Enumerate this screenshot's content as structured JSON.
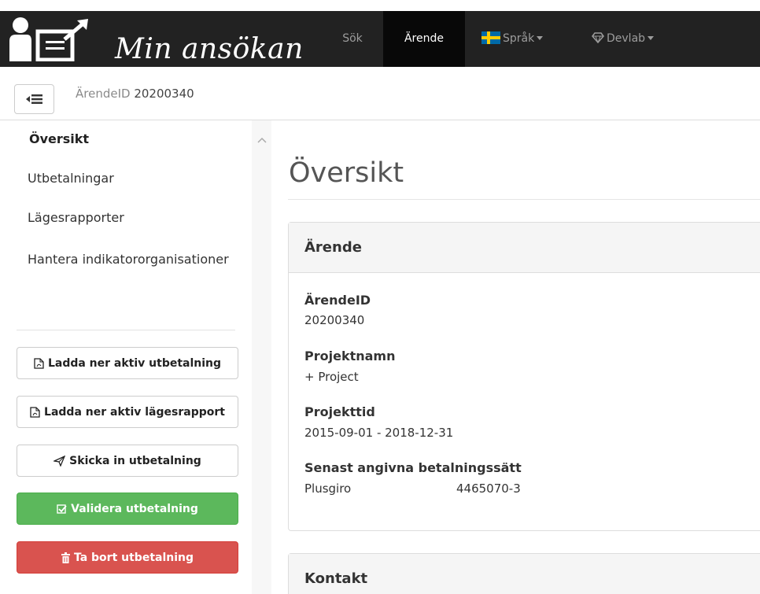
{
  "app": {
    "title": "Min ansökan"
  },
  "nav": {
    "items": [
      {
        "label": "Sök",
        "active": false
      },
      {
        "label": "Ärende",
        "active": true
      },
      {
        "label": "Språk",
        "icon": "swedish-flag-icon",
        "dropdown": true
      },
      {
        "label": "Devlab",
        "icon": "diamond-icon",
        "dropdown": true
      }
    ]
  },
  "breadcrumb": {
    "label": "ÄrendeID",
    "value": "20200340"
  },
  "sidebar": {
    "items": [
      {
        "label": "Översikt",
        "active": true
      },
      {
        "label": "Utbetalningar"
      },
      {
        "label": "Lägesrapporter"
      },
      {
        "label": "Hantera indikatororganisationer"
      }
    ],
    "buttons": [
      {
        "label": "Ladda ner aktiv utbetalning",
        "icon": "pdf-file-icon"
      },
      {
        "label": "Ladda ner aktiv lägesrapport",
        "icon": "pdf-file-icon"
      },
      {
        "label": "Skicka in utbetalning",
        "icon": "paper-plane-icon"
      },
      {
        "label": "Validera utbetalning",
        "icon": "check-square-icon",
        "color": "#5cb85c"
      },
      {
        "label": "Ta bort utbetalning",
        "icon": "trash-icon",
        "color": "#d9534f"
      }
    ]
  },
  "main": {
    "heading": "Översikt",
    "arende_panel": {
      "title": "Ärende",
      "fields": [
        {
          "label": "ÄrendeID",
          "value": "20200340"
        },
        {
          "label": "Projektnamn",
          "value": "+ Project"
        },
        {
          "label": "Projekttid",
          "value": "2015-09-01 - 2018-12-31"
        },
        {
          "label": "Senast angivna betalningssätt",
          "value": "Plusgiro",
          "value2": "4465070-3"
        }
      ]
    },
    "kontakt_panel": {
      "title": "Kontakt"
    }
  },
  "colors": {
    "navbar": "#222222",
    "nav_active": "#080808",
    "success": "#5cb85c",
    "danger": "#d9534f"
  }
}
